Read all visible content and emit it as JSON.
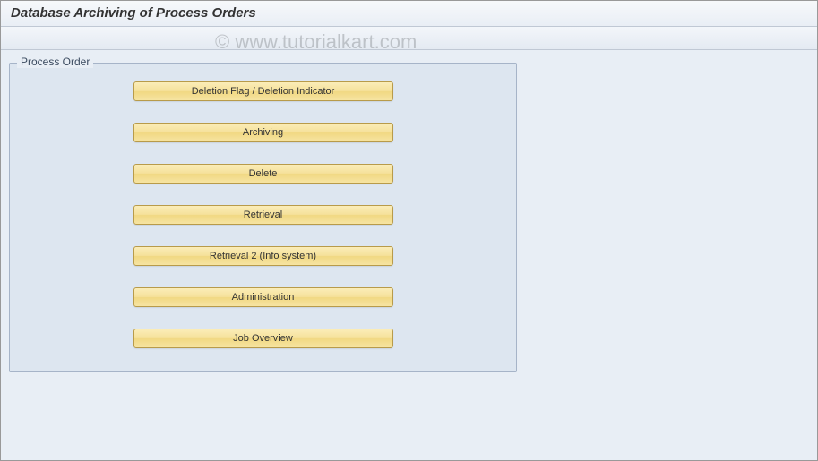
{
  "header": {
    "title": "Database Archiving of Process Orders"
  },
  "watermark": "© www.tutorialkart.com",
  "group": {
    "title": "Process Order",
    "buttons": [
      {
        "label": "Deletion Flag / Deletion Indicator",
        "name": "deletion-flag-button"
      },
      {
        "label": "Archiving",
        "name": "archiving-button"
      },
      {
        "label": "Delete",
        "name": "delete-button"
      },
      {
        "label": "Retrieval",
        "name": "retrieval-button"
      },
      {
        "label": "Retrieval 2 (Info system)",
        "name": "retrieval-2-button"
      },
      {
        "label": "Administration",
        "name": "administration-button"
      },
      {
        "label": "Job Overview",
        "name": "job-overview-button"
      }
    ]
  }
}
